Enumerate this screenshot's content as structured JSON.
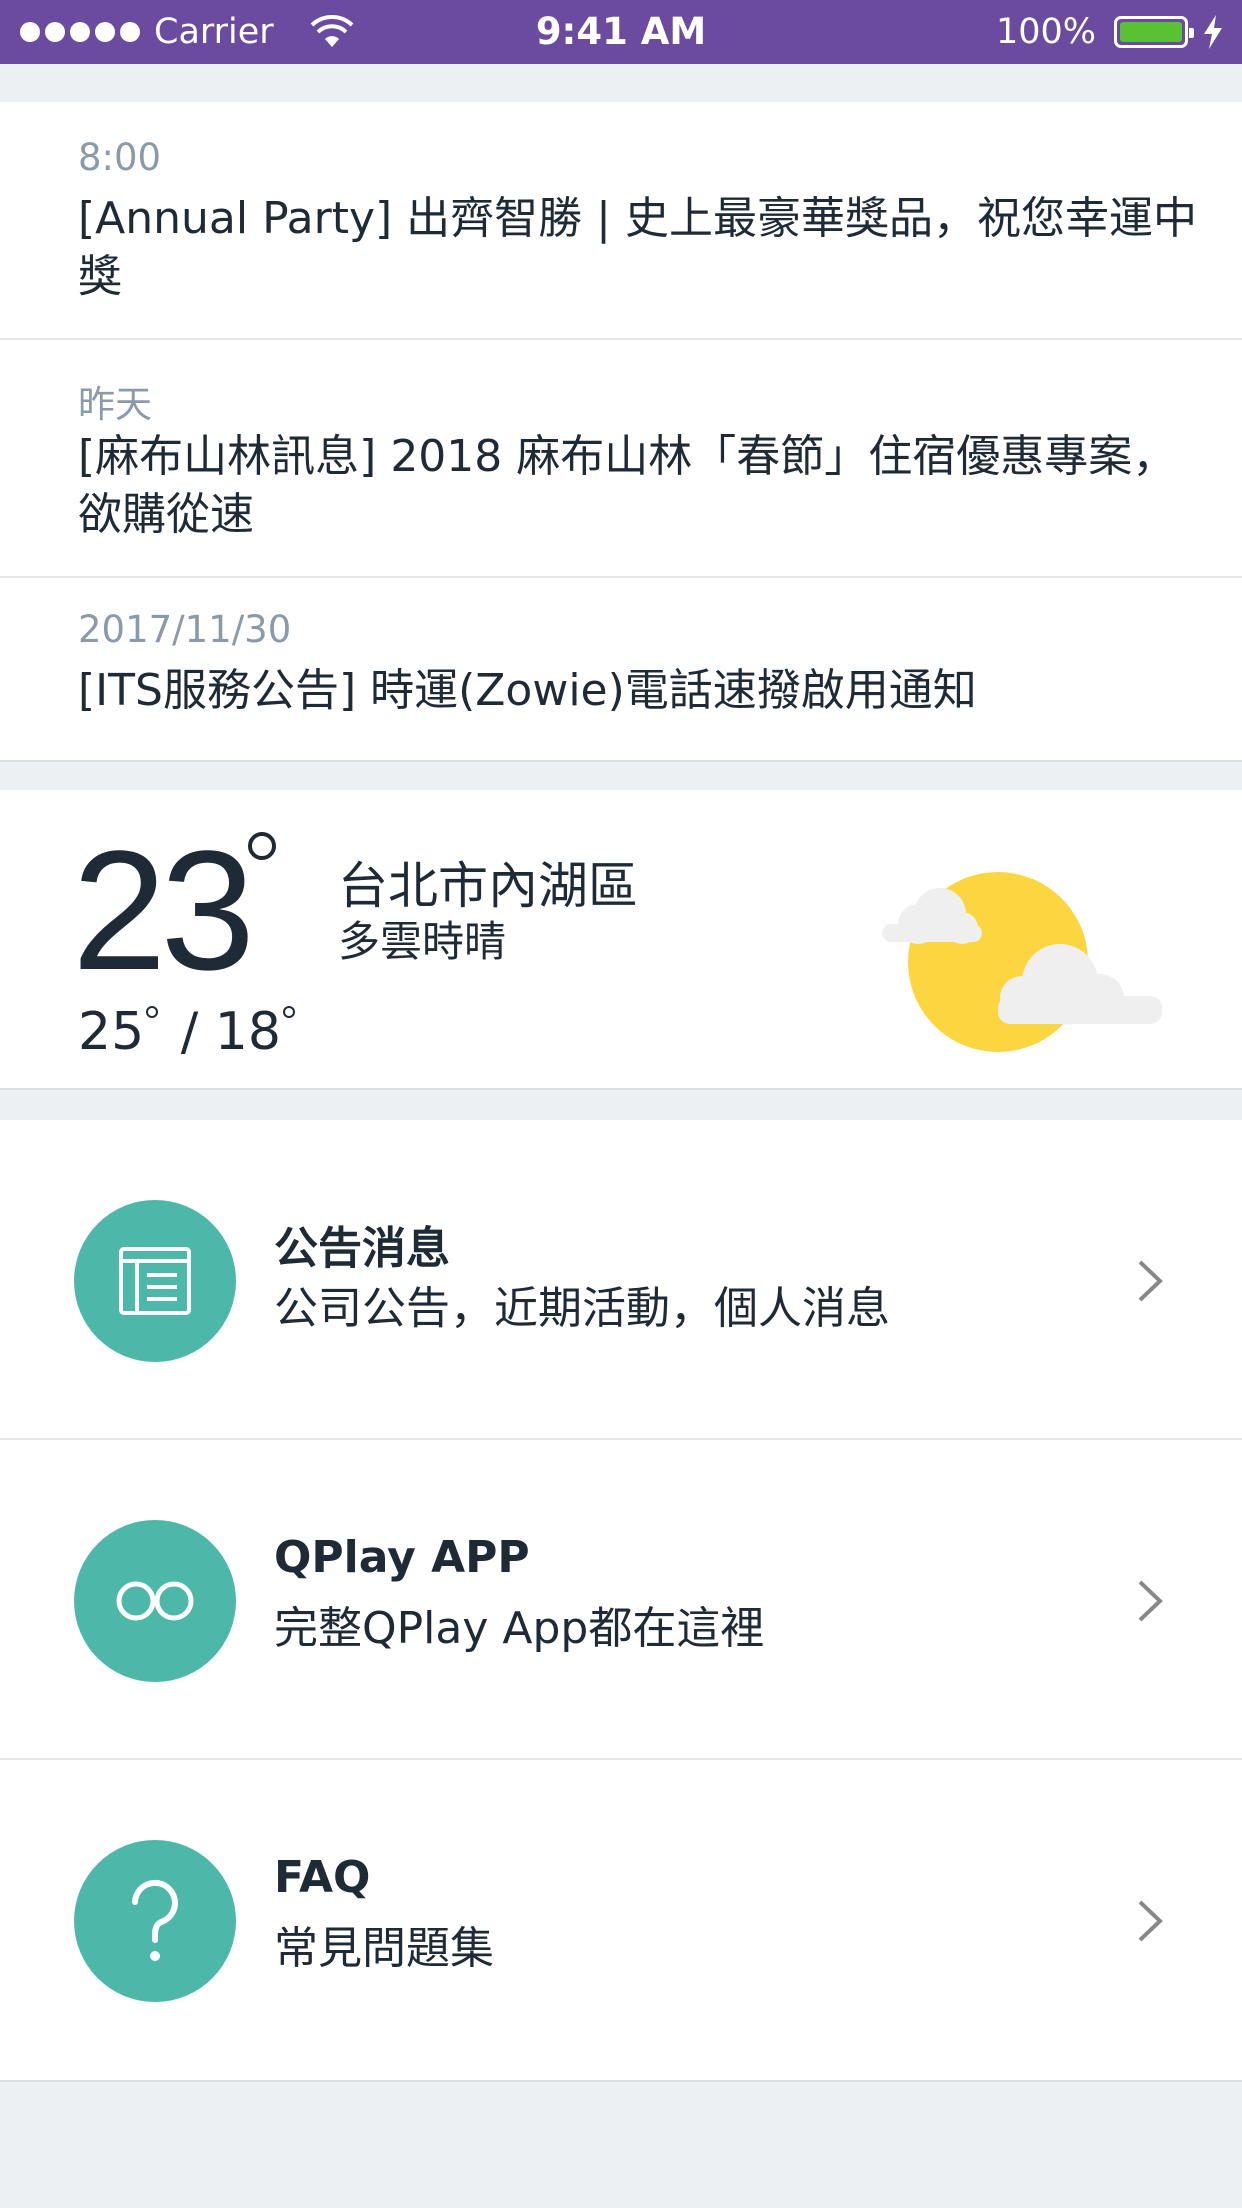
{
  "status_bar": {
    "carrier": "Carrier",
    "time": "9:41 AM",
    "battery": "100%",
    "battery_color": "#5AC135",
    "bar_color": "#6A4BA0"
  },
  "news": [
    {
      "date": "8:00",
      "title": "[Annual Party] 出齊智勝 | 史上最豪華獎品，祝您幸運中獎"
    },
    {
      "date": "昨天",
      "title": "[麻布山林訊息] 2018 麻布山林「春節」住宿優惠專案，欲購從速"
    },
    {
      "date": "2017/11/30",
      "title": "[ITS服務公告] 時運(Zowie)電話速撥啟用通知"
    }
  ],
  "weather": {
    "temp": "23",
    "high": "25",
    "low": "18",
    "range_sep": " / ",
    "location": "台北市內湖區",
    "condition": "多雲時晴",
    "icon": "sun-with-clouds-icon"
  },
  "menu": [
    {
      "title": "公告消息",
      "subtitle": "公司公告，近期活動，個人消息",
      "icon": "news-icon"
    },
    {
      "title": "QPlay APP",
      "subtitle": "完整QPlay App都在這裡",
      "icon": "infinity-icon"
    },
    {
      "title": "FAQ",
      "subtitle": "常見問題集",
      "icon": "question-icon"
    }
  ],
  "colors": {
    "accent": "#4DB8AA",
    "sun": "#FCD640",
    "background": "#EDF0F3"
  }
}
